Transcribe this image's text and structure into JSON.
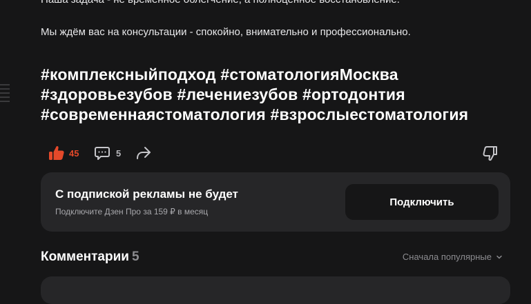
{
  "article": {
    "cut_line": "Наша задача - не временное облегчение, а полноценное восстановление.",
    "paragraph": "Мы ждём вас на консультации - спокойно, внимательно и профессионально.",
    "hashtags": [
      "#комплексныйподход",
      "#стоматологияМосква",
      "#здоровьезубов",
      "#лечениезубов",
      "#ортодонтия",
      "#современнаястоматология",
      "#взрослыестоматология"
    ]
  },
  "actions": {
    "likes": "45",
    "comments": "5",
    "like_icon": "thumbs-up-icon",
    "comment_icon": "comment-icon",
    "share_icon": "share-icon",
    "dislike_icon": "thumbs-down-icon",
    "like_color": "#e5492a"
  },
  "promo": {
    "title": "С подпиской рекламы не будет",
    "subtitle": "Подключите Дзен Про за 159 ₽ в месяц",
    "button": "Подключить"
  },
  "comments": {
    "title": "Комментарии",
    "count": "5",
    "sort_label": "Сначала популярные"
  },
  "colors": {
    "background": "#161617",
    "card": "#262628",
    "accent": "#e5492a"
  }
}
